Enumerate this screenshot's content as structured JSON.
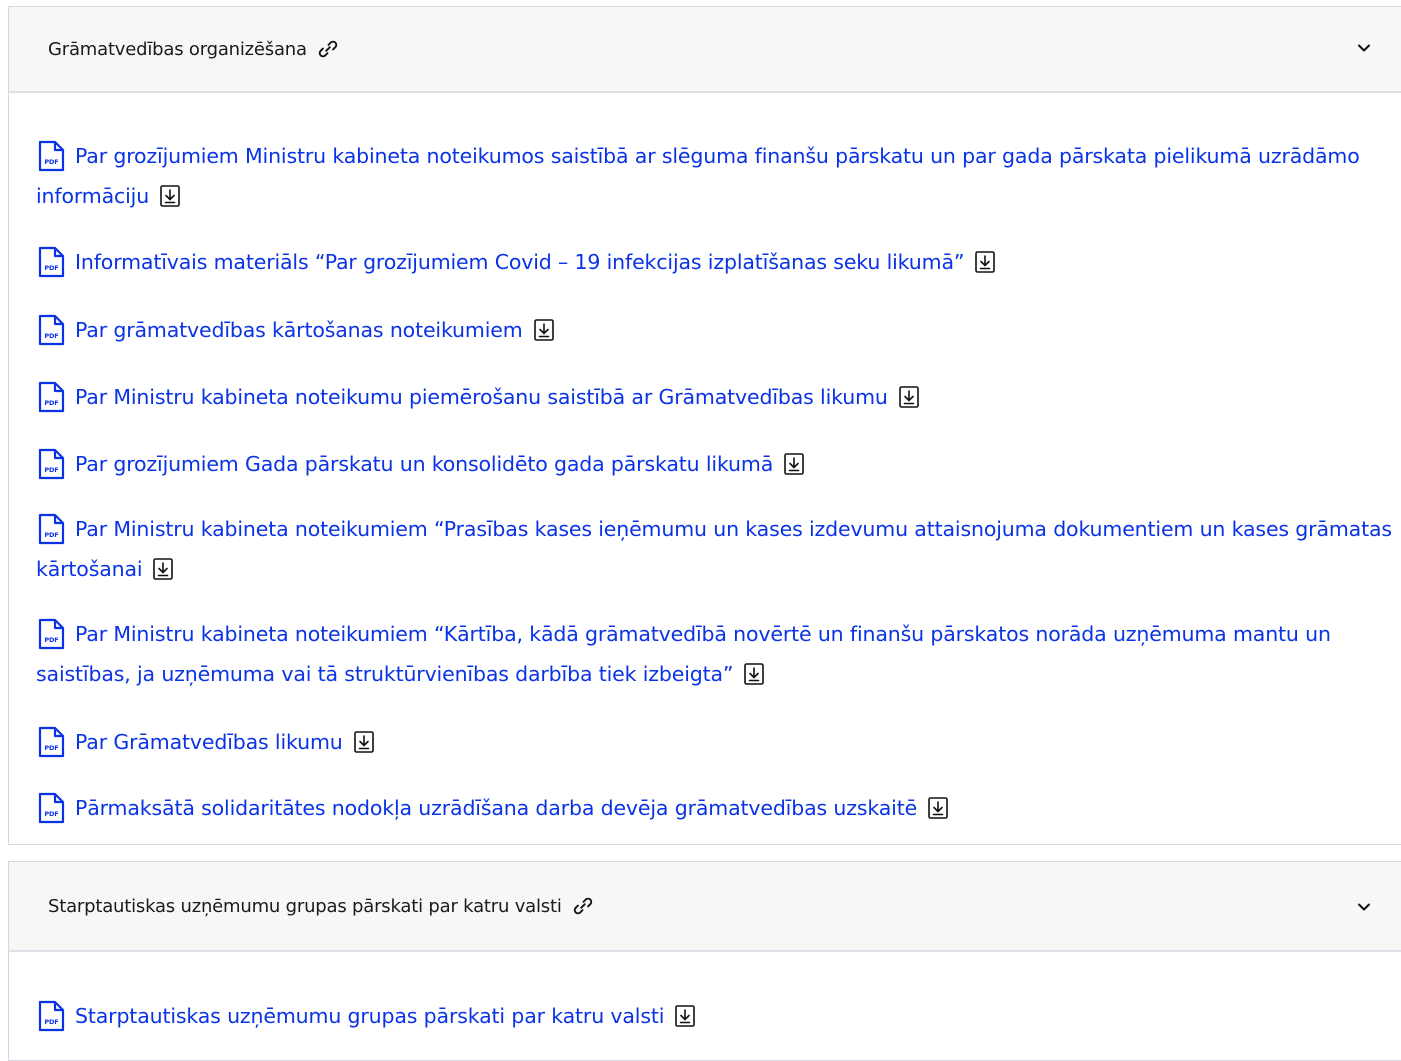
{
  "sections": [
    {
      "title": "Grāmatvedības organizēšana",
      "items": [
        "Par grozījumiem Ministru kabineta noteikumos saistībā ar slēguma finanšu pārskatu un par gada pārskata pielikumā uzrādāmo informāciju",
        "Informatīvais materiāls “Par grozījumiem Covid – 19 infekcijas izplatīšanas seku likumā”",
        "Par grāmatvedības kārtošanas noteikumiem",
        "Par Ministru kabineta noteikumu piemērošanu saistībā ar Grāmatvedības likumu",
        "Par grozījumiem Gada pārskatu un konsolidēto gada pārskatu likumā",
        "Par Ministru kabineta noteikumiem “Prasības kases ieņēmumu un kases izdevumu attaisnojuma dokumentiem un kases grāmatas kārtošanai",
        "Par Ministru kabineta noteikumiem “Kārtība, kādā grāmatvedībā novērtē un finanšu pārskatos norāda uzņēmuma mantu un saistības, ja uzņēmuma vai tā struktūrvienības darbība tiek izbeigta”",
        "Par Grāmatvedības likumu",
        "Pārmaksātā solidaritātes nodokļa uzrādīšana darba devēja grāmatvedības uzskaitē"
      ]
    },
    {
      "title": "Starptautiskas uzņēmumu grupas pārskati par katru valsti",
      "items": [
        "Starptautiskas uzņēmumu grupas pārskati par katru valsti"
      ]
    }
  ],
  "icons": {
    "pdf_label": "PDF",
    "link": "link-icon",
    "download": "download-icon",
    "chevron": "chevron-down-icon"
  },
  "colors": {
    "link": "#0a33e6",
    "header_bg": "#f7f7f7"
  }
}
